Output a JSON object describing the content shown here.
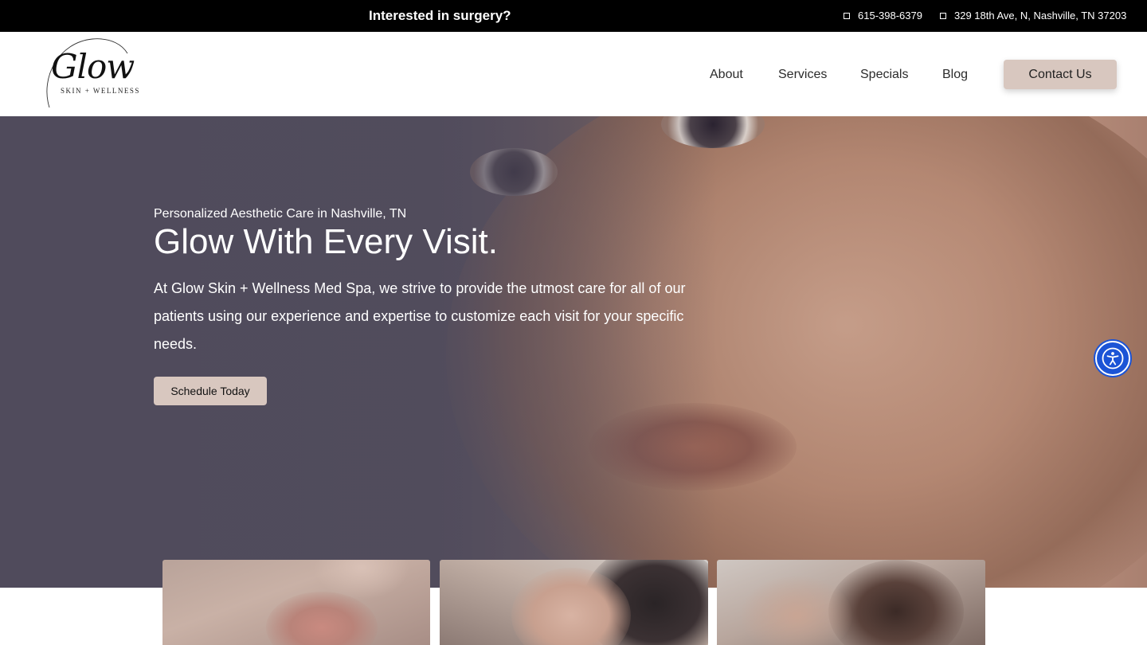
{
  "topbar": {
    "promo": "Interested in surgery?",
    "phone": "615-398-6379",
    "address": "329 18th Ave, N, Nashville, TN 37203"
  },
  "logo": {
    "name": "Glow",
    "tagline": "SKIN + WELLNESS"
  },
  "nav": {
    "items": [
      "About",
      "Services",
      "Specials",
      "Blog"
    ],
    "contact": "Contact Us"
  },
  "hero": {
    "eyebrow": "Personalized Aesthetic Care in Nashville, TN",
    "headline": "Glow With Every Visit.",
    "description": "At Glow Skin + Wellness Med Spa, we strive to provide the utmost care for all of our patients using our experience and expertise to customize each visit for your specific needs.",
    "cta": "Schedule Today"
  },
  "accessibility": {
    "icon": "accessibility-icon",
    "color": "#1b54d6"
  },
  "colors": {
    "accent": "#d8c7bf",
    "topbar": "#000000",
    "hero_overlay": "#504b5a"
  }
}
